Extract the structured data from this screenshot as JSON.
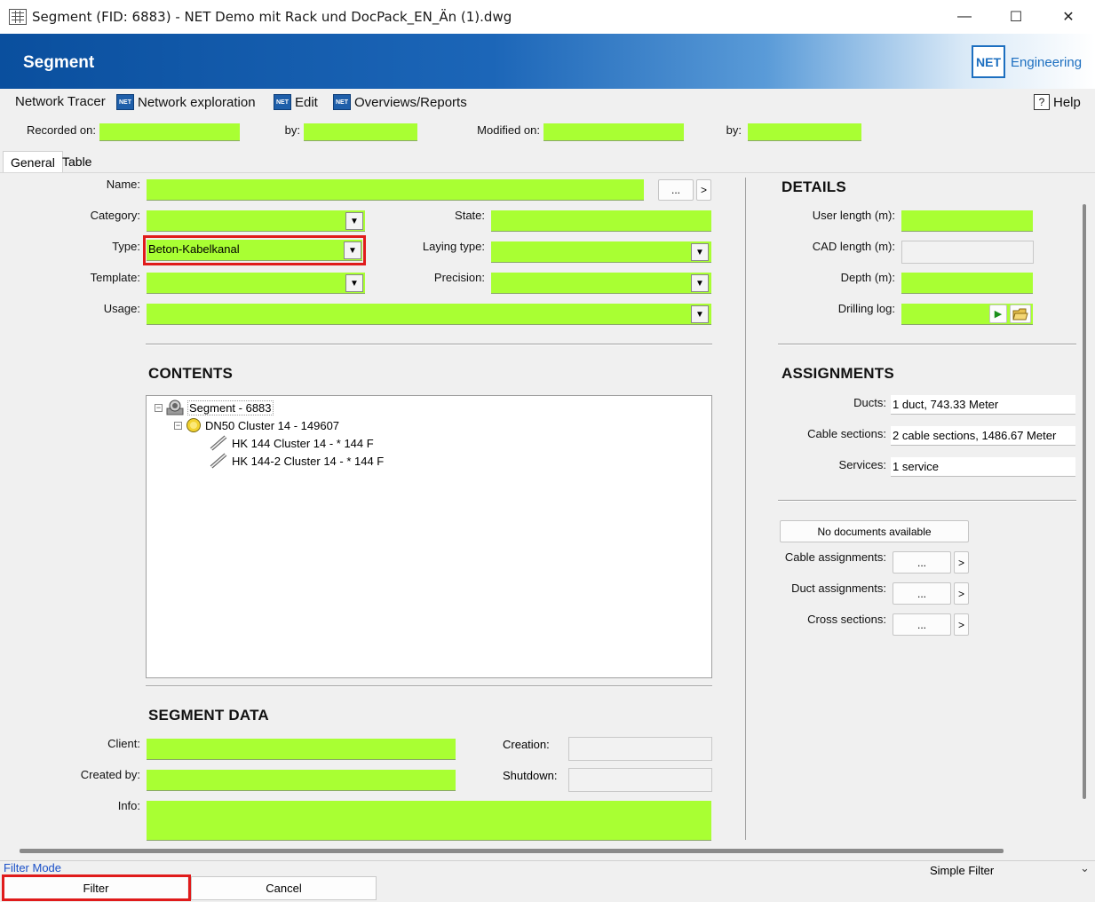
{
  "window": {
    "title": "Segment (FID: 6883) - NET Demo mit Rack und DocPack_EN_Än (1).dwg",
    "min": "—",
    "max": "☐",
    "close": "✕"
  },
  "banner": {
    "title": "Segment",
    "logo": "NET",
    "logo_text": "Engineering"
  },
  "menu": {
    "network_tracer": "Network Tracer",
    "network_exploration": "Network exploration",
    "edit": "Edit",
    "overviews": "Overviews/Reports",
    "help": "Help",
    "net_icon": "NET"
  },
  "record": {
    "recorded_on": "Recorded on:",
    "by": "by:",
    "modified_on": "Modified on:",
    "by2": "by:"
  },
  "tabs": [
    "General",
    "Table"
  ],
  "general": {
    "name_label": "Name:",
    "category_label": "Category:",
    "type_label": "Type:",
    "type_value": "Beton-Kabelkanal",
    "template_label": "Template:",
    "usage_label": "Usage:",
    "state_label": "State:",
    "laying_type_label": "Laying type:",
    "precision_label": "Precision:",
    "ellipsis": "...",
    "arrow": ">",
    "dropdown": "▼"
  },
  "contents": {
    "title": "CONTENTS",
    "tree": [
      {
        "label": "Segment - 6883",
        "expander": "−"
      },
      {
        "label": "DN50 Cluster 14 - 149607",
        "expander": "−"
      },
      {
        "label": "HK 144 Cluster 14 - * 144 F"
      },
      {
        "label": "HK 144-2 Cluster 14 - * 144 F"
      }
    ]
  },
  "segment_data": {
    "title": "SEGMENT DATA",
    "client_label": "Client:",
    "created_by_label": "Created by:",
    "info_label": "Info:",
    "creation_label": "Creation:",
    "shutdown_label": "Shutdown:"
  },
  "details": {
    "title": "DETAILS",
    "user_length_label": "User length (m):",
    "cad_length_label": "CAD length (m):",
    "depth_label": "Depth (m):",
    "drilling_log_label": "Drilling log:",
    "play_icon": "▶",
    "folder_icon": "📂"
  },
  "assignments": {
    "title": "ASSIGNMENTS",
    "ducts_label": "Ducts:",
    "ducts_value": "1 duct, 743.33 Meter",
    "cable_sections_label": "Cable sections:",
    "cable_sections_value": "2 cable sections, 1486.67 Meter",
    "services_label": "Services:",
    "services_value": "1 service",
    "no_documents": "No documents available",
    "cable_assignments_label": "Cable assignments:",
    "duct_assignments_label": "Duct assignments:",
    "cross_sections_label": "Cross sections:"
  },
  "footer": {
    "filter_mode": "Filter Mode",
    "simple_filter": "Simple Filter",
    "chevron": "⌄",
    "filter_button": "Filter",
    "cancel_button": "Cancel"
  },
  "colors": {
    "field_green": "#a9ff33",
    "highlight_red": "#e01b1b",
    "banner_blue": "#0a4f9e"
  }
}
